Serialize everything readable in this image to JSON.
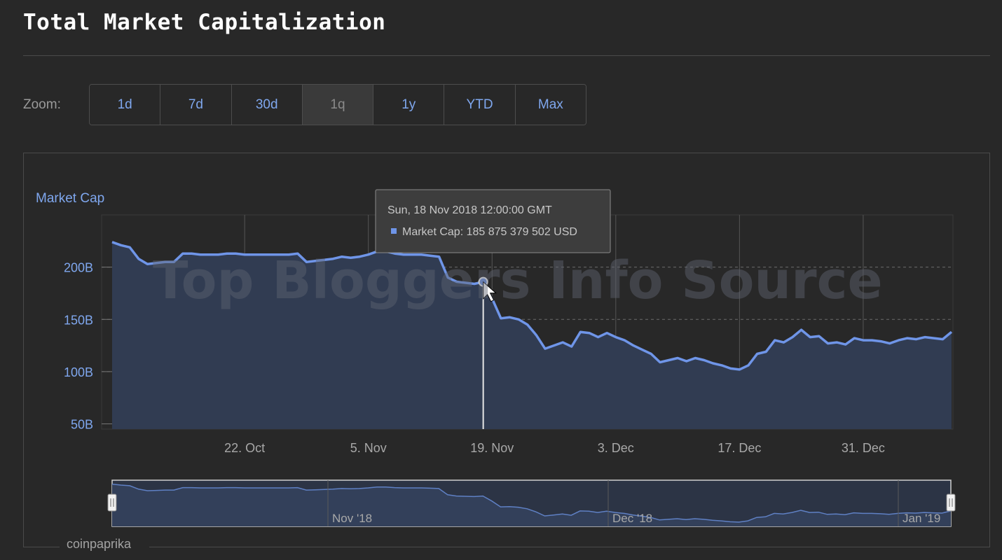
{
  "title": "Total Market Capitalization",
  "zoom": {
    "label": "Zoom:",
    "buttons": [
      "1d",
      "7d",
      "30d",
      "1q",
      "1y",
      "YTD",
      "Max"
    ],
    "active": "1q"
  },
  "tooltip": {
    "date": "Sun, 18 Nov 2018 12:00:00 GMT",
    "series_label": "Market Cap:",
    "value": "185 875 379 502 USD"
  },
  "watermark": "Top Bloggers Info Source",
  "credit": "coinpaprika",
  "colors": {
    "series": "#6f95e8",
    "area": "#313c52",
    "grid": "#555555"
  },
  "chart_data": {
    "type": "area",
    "title": "",
    "ylabel": "Market Cap",
    "ylim": [
      45,
      250
    ],
    "y_ticks": [
      {
        "value": 50,
        "label": "50B"
      },
      {
        "value": 100,
        "label": "100B"
      },
      {
        "value": 150,
        "label": "150B"
      },
      {
        "value": 200,
        "label": "200B"
      }
    ],
    "x_range": [
      "2018-10-07",
      "2019-01-10"
    ],
    "x_ticks": [
      {
        "date": "2018-10-22",
        "label": "22. Oct"
      },
      {
        "date": "2018-11-05",
        "label": "5. Nov"
      },
      {
        "date": "2018-11-19",
        "label": "19. Nov"
      },
      {
        "date": "2018-12-03",
        "label": "3. Dec"
      },
      {
        "date": "2018-12-17",
        "label": "17. Dec"
      },
      {
        "date": "2018-12-31",
        "label": "31. Dec"
      }
    ],
    "series": [
      {
        "name": "Market Cap",
        "points": [
          [
            "2018-10-07",
            224
          ],
          [
            "2018-10-08",
            221
          ],
          [
            "2018-10-09",
            219
          ],
          [
            "2018-10-10",
            208
          ],
          [
            "2018-10-11",
            203
          ],
          [
            "2018-10-12",
            204
          ],
          [
            "2018-10-13",
            205
          ],
          [
            "2018-10-14",
            205
          ],
          [
            "2018-10-15",
            213
          ],
          [
            "2018-10-16",
            213
          ],
          [
            "2018-10-17",
            212
          ],
          [
            "2018-10-18",
            212
          ],
          [
            "2018-10-19",
            212
          ],
          [
            "2018-10-20",
            213
          ],
          [
            "2018-10-21",
            213
          ],
          [
            "2018-10-22",
            212
          ],
          [
            "2018-10-23",
            212
          ],
          [
            "2018-10-24",
            212
          ],
          [
            "2018-10-25",
            212
          ],
          [
            "2018-10-26",
            212
          ],
          [
            "2018-10-27",
            212
          ],
          [
            "2018-10-28",
            213
          ],
          [
            "2018-10-29",
            205
          ],
          [
            "2018-10-30",
            206
          ],
          [
            "2018-10-31",
            207
          ],
          [
            "2018-11-01",
            208
          ],
          [
            "2018-11-02",
            210
          ],
          [
            "2018-11-03",
            209
          ],
          [
            "2018-11-04",
            210
          ],
          [
            "2018-11-05",
            212
          ],
          [
            "2018-11-06",
            215
          ],
          [
            "2018-11-07",
            215
          ],
          [
            "2018-11-08",
            213
          ],
          [
            "2018-11-09",
            212
          ],
          [
            "2018-11-10",
            212
          ],
          [
            "2018-11-11",
            212
          ],
          [
            "2018-11-12",
            211
          ],
          [
            "2018-11-13",
            210
          ],
          [
            "2018-11-14",
            190
          ],
          [
            "2018-11-15",
            186
          ],
          [
            "2018-11-16",
            185
          ],
          [
            "2018-11-17",
            184
          ],
          [
            "2018-11-18",
            185.9
          ],
          [
            "2018-11-19",
            170
          ],
          [
            "2018-11-20",
            151
          ],
          [
            "2018-11-21",
            152
          ],
          [
            "2018-11-22",
            150
          ],
          [
            "2018-11-23",
            145
          ],
          [
            "2018-11-24",
            135
          ],
          [
            "2018-11-25",
            122
          ],
          [
            "2018-11-26",
            125
          ],
          [
            "2018-11-27",
            128
          ],
          [
            "2018-11-28",
            124
          ],
          [
            "2018-11-29",
            138
          ],
          [
            "2018-11-30",
            137
          ],
          [
            "2018-12-01",
            133
          ],
          [
            "2018-12-02",
            137
          ],
          [
            "2018-12-03",
            133
          ],
          [
            "2018-12-04",
            130
          ],
          [
            "2018-12-05",
            125
          ],
          [
            "2018-12-06",
            121
          ],
          [
            "2018-12-07",
            117
          ],
          [
            "2018-12-08",
            109
          ],
          [
            "2018-12-09",
            111
          ],
          [
            "2018-12-10",
            113
          ],
          [
            "2018-12-11",
            110
          ],
          [
            "2018-12-12",
            113
          ],
          [
            "2018-12-13",
            111
          ],
          [
            "2018-12-14",
            108
          ],
          [
            "2018-12-15",
            106
          ],
          [
            "2018-12-16",
            103
          ],
          [
            "2018-12-17",
            102
          ],
          [
            "2018-12-18",
            106
          ],
          [
            "2018-12-19",
            117
          ],
          [
            "2018-12-20",
            119
          ],
          [
            "2018-12-21",
            130
          ],
          [
            "2018-12-22",
            128
          ],
          [
            "2018-12-23",
            133
          ],
          [
            "2018-12-24",
            140
          ],
          [
            "2018-12-25",
            133
          ],
          [
            "2018-12-26",
            134
          ],
          [
            "2018-12-27",
            127
          ],
          [
            "2018-12-28",
            128
          ],
          [
            "2018-12-29",
            126
          ],
          [
            "2018-12-30",
            132
          ],
          [
            "2018-12-31",
            130
          ],
          [
            "2019-01-01",
            130
          ],
          [
            "2019-01-02",
            129
          ],
          [
            "2019-01-03",
            127
          ],
          [
            "2019-01-04",
            130
          ],
          [
            "2019-01-05",
            132
          ],
          [
            "2019-01-06",
            131
          ],
          [
            "2019-01-07",
            133
          ],
          [
            "2019-01-08",
            132
          ],
          [
            "2019-01-09",
            131
          ],
          [
            "2019-01-10",
            138
          ]
        ]
      }
    ],
    "navigator": {
      "labels": [
        "Nov '18",
        "Dec '18",
        "Jan '19"
      ]
    }
  }
}
